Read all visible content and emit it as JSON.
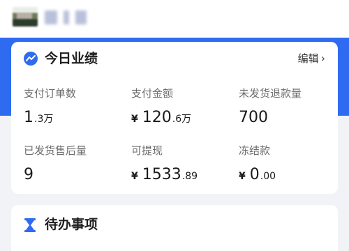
{
  "header": {
    "shop_name": ""
  },
  "performance_card": {
    "title": "今日业绩",
    "edit_label": "编辑",
    "metrics": [
      {
        "label": "支付订单数",
        "currency": "",
        "value": "1",
        "small": ".3万"
      },
      {
        "label": "支付金额",
        "currency": "¥",
        "value": "120",
        "small": ".6万"
      },
      {
        "label": "未发货退款量",
        "currency": "",
        "value": "700",
        "small": ""
      },
      {
        "label": "已发货售后量",
        "currency": "",
        "value": "9",
        "small": ""
      },
      {
        "label": "可提现",
        "currency": "¥",
        "value": "1533",
        "small": ".89"
      },
      {
        "label": "冻结款",
        "currency": "¥",
        "value": "0",
        "small": ".00"
      }
    ]
  },
  "todo_card": {
    "title": "待办事项"
  },
  "colors": {
    "accent": "#2f6bf0",
    "card_bg": "#ffffff",
    "page_bg": "#f2f3f7"
  }
}
